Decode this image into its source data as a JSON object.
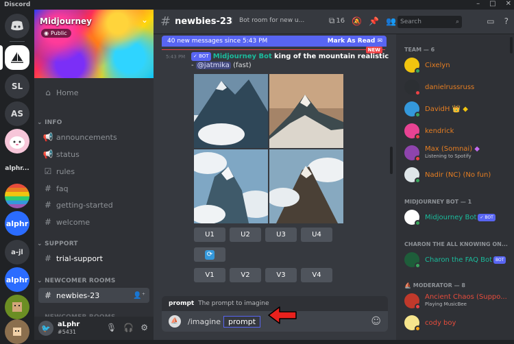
{
  "window": {
    "title": "Discord",
    "controls": [
      "–",
      "□",
      "✕"
    ]
  },
  "servers": [
    {
      "label": "",
      "icon": "discord-logo-icon"
    },
    {
      "label": "",
      "icon": "sailboat-icon"
    },
    {
      "label": "SL"
    },
    {
      "label": "AS"
    },
    {
      "label": "",
      "icon": "pink-blob-icon"
    },
    {
      "label": "alphr..."
    },
    {
      "label": "",
      "icon": "rainbow-flag-icon"
    },
    {
      "label": "alphr"
    },
    {
      "label": "a-jl"
    },
    {
      "label": "alphr"
    },
    {
      "label": "",
      "icon": "pixel-avatar-icon"
    },
    {
      "label": "",
      "icon": "pixel-avatar-icon"
    }
  ],
  "server": {
    "name": "Midjourney",
    "badge": "Public"
  },
  "sidebar": {
    "home": "Home",
    "categories": {
      "info": "INFO",
      "support": "SUPPORT",
      "newcomer": "NEWCOMER ROOMS",
      "newcomer2": "NEWCOMER ROOMS"
    },
    "info_channels": [
      "announcements",
      "status",
      "rules",
      "faq",
      "getting-started",
      "welcome"
    ],
    "support_channels": [
      "trial-support"
    ],
    "newcomer_channels": [
      "newbies-23"
    ]
  },
  "user": {
    "name": "aLphr",
    "tag": "#5431"
  },
  "channel": {
    "name": "newbies-23",
    "topic": "Bot room for new u...",
    "thread_count": "16",
    "new_messages": "40 new messages since 5:43 PM",
    "mark_read": "Mark As Read",
    "new_label": "NEW"
  },
  "message": {
    "time": "5:43 PM",
    "bot_badge": "✓ BOT",
    "author": "Midjourney Bot",
    "prompt": "king of the mountain realistic",
    "separator": " - ",
    "mention": "@jatmika",
    "mode": "(fast)"
  },
  "buttons": {
    "upscale": [
      "U1",
      "U2",
      "U3",
      "U4"
    ],
    "variation": [
      "V1",
      "V2",
      "V3",
      "V4"
    ],
    "refresh_icon": "refresh-icon"
  },
  "composer": {
    "hint_name": "prompt",
    "hint_desc": "The prompt to imagine",
    "command": "/imagine",
    "option": "prompt"
  },
  "member_search": {
    "placeholder": "Search"
  },
  "members": {
    "team_header": "TEAM — 6",
    "team": [
      {
        "name": "Cixelyn",
        "color": "#e67e22",
        "status": "#3ba55d"
      },
      {
        "name": "danielrussruss",
        "color": "#e67e22",
        "status": "#ed4245"
      },
      {
        "name": "DavidH",
        "color": "#e67e22",
        "status": "#3ba55d",
        "suffix": "👑 ◆"
      },
      {
        "name": "kendrick",
        "color": "#e67e22",
        "status": "#ed4245"
      },
      {
        "name": "Max (Somnai)",
        "color": "#e67e22",
        "status": "#ed4245",
        "suffix": "◆",
        "activity": "Listening to Spotify"
      },
      {
        "name": "Nadir (NC) (No fun)",
        "color": "#e67e22",
        "status": "#3ba55d"
      }
    ],
    "bot_header": "MIDJOURNEY BOT — 1",
    "bots": [
      {
        "name": "Midjourney Bot",
        "color": "#1abc9c",
        "badge": "✓ BOT"
      }
    ],
    "faq_header": "CHARON THE ALL KNOWING ON...",
    "faq": [
      {
        "name": "Charon the FAQ Bot",
        "color": "#1abc9c",
        "badge": "BOT"
      }
    ],
    "mod_header": "MODERATOR — 8",
    "mods": [
      {
        "name": "Ancient Chaos (Suppo...",
        "color": "#e74c3c",
        "status": "#ed4245",
        "activity": "Playing MusicBee"
      },
      {
        "name": "cody boy",
        "color": "#e74c3c",
        "status": "#faa61a"
      }
    ]
  },
  "colors": {
    "accent": "#5865f2",
    "bot_author": "#1abc9c",
    "team_name": "#e67e22",
    "mod_name": "#e74c3c",
    "unread": "#ed4245"
  }
}
